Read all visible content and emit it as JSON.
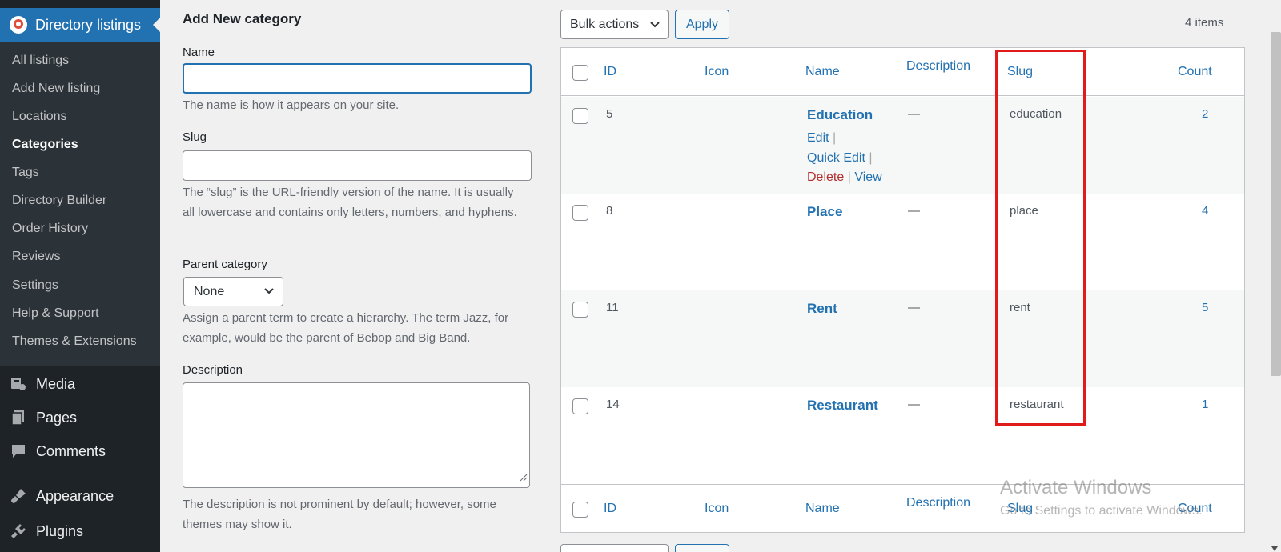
{
  "sidebar": {
    "active_menu": "Directory listings",
    "submenu": [
      {
        "label": "All listings"
      },
      {
        "label": "Add New listing"
      },
      {
        "label": "Locations"
      },
      {
        "label": "Categories",
        "current": true
      },
      {
        "label": "Tags"
      },
      {
        "label": "Directory Builder"
      },
      {
        "label": "Order History"
      },
      {
        "label": "Reviews"
      },
      {
        "label": "Settings"
      },
      {
        "label": "Help & Support"
      },
      {
        "label": "Themes & Extensions"
      }
    ],
    "menu": [
      {
        "label": "Media",
        "icon": "media-icon"
      },
      {
        "label": "Pages",
        "icon": "pages-icon"
      },
      {
        "label": "Comments",
        "icon": "comments-icon"
      },
      {
        "label": "Appearance",
        "icon": "appearance-icon"
      },
      {
        "label": "Plugins",
        "icon": "plugins-icon"
      }
    ]
  },
  "form": {
    "title": "Add New category",
    "name_label": "Name",
    "name_value": "",
    "name_help": "The name is how it appears on your site.",
    "slug_label": "Slug",
    "slug_value": "",
    "slug_help": "The “slug” is the URL-friendly version of the name. It is usually all lowercase and contains only letters, numbers, and hyphens.",
    "parent_label": "Parent category",
    "parent_value": "None",
    "parent_help": "Assign a parent term to create a hierarchy. The term Jazz, for example, would be the parent of Bebop and Big Band.",
    "description_label": "Description",
    "description_value": "",
    "description_help": "The description is not prominent by default; however, some themes may show it."
  },
  "tablenav": {
    "bulk_actions": "Bulk actions",
    "apply": "Apply",
    "items_count": "4 items"
  },
  "table": {
    "columns": {
      "id": "ID",
      "icon": "Icon",
      "name": "Name",
      "description": "Description",
      "slug": "Slug",
      "count": "Count"
    },
    "rows": [
      {
        "id": "5",
        "name": "Education",
        "description": "—",
        "slug": "education",
        "count": "2"
      },
      {
        "id": "8",
        "name": "Place",
        "description": "—",
        "slug": "place",
        "count": "4"
      },
      {
        "id": "11",
        "name": "Rent",
        "description": "—",
        "slug": "rent",
        "count": "5"
      },
      {
        "id": "14",
        "name": "Restaurant",
        "description": "—",
        "slug": "restaurant",
        "count": "1"
      }
    ],
    "row_actions": {
      "edit": "Edit",
      "quick_edit": "Quick Edit",
      "delete": "Delete",
      "view": "View",
      "separator": "|"
    }
  },
  "watermark": {
    "line1": "Activate Windows",
    "line2": "Go to Settings to activate Windows."
  },
  "colors": {
    "accent": "#2271b1",
    "sidebar_bg": "#1d2327",
    "highlight": "#e01b1b",
    "delete": "#b32d2e"
  }
}
